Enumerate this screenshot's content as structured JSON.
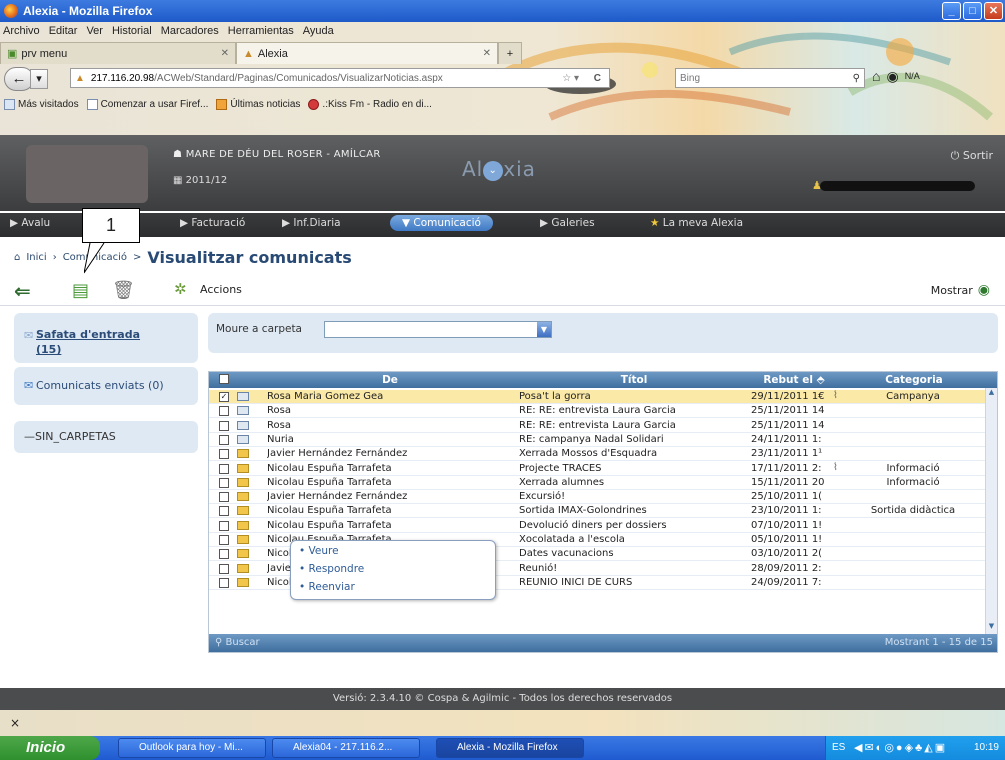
{
  "window": {
    "title": "Alexia - Mozilla Firefox"
  },
  "menubar": [
    "Archivo",
    "Editar",
    "Ver",
    "Historial",
    "Marcadores",
    "Herramientas",
    "Ayuda"
  ],
  "tabs": [
    {
      "label": "prv menu"
    },
    {
      "label": "Alexia"
    }
  ],
  "url": {
    "host": "217.116.20.98",
    "path": "/ACWeb/Standard/Paginas/Comunicados/VisualizarNoticias.aspx"
  },
  "search": {
    "placeholder": "Bing"
  },
  "addon_label": "N/A",
  "bookmarks": [
    "Más visitados",
    "Comenzar a usar Firef...",
    "Últimas noticias",
    ".:Kiss Fm - Radio en di..."
  ],
  "app": {
    "school": "MARE DE DÉU DEL ROSER - AMÍLCAR",
    "year": "2011/12",
    "brand": "Alexia",
    "sortir": "Sortir"
  },
  "nav": [
    "Avalu",
    "Facturació",
    "Inf.Diaria",
    "Comunicació",
    "Galeries",
    "La meva Alexia"
  ],
  "breadcrumb": {
    "home": "Inici",
    "section": "Comunicació",
    "current": "Visualitzar comunicats"
  },
  "callout": "1",
  "toolbar": {
    "accions": "Accions",
    "mostrar": "Mostrar"
  },
  "sidebar": {
    "inbox": "Safata d'entrada (15)",
    "sent": "Comunicats enviats (0)",
    "folders": "—SIN_CARPETAS"
  },
  "folder_bar": {
    "label": "Moure a carpeta"
  },
  "grid": {
    "columns": [
      "De",
      "Títol",
      "Rebut el",
      "Categoria"
    ],
    "rows": [
      {
        "from": "Rosa Maria Gomez Gea",
        "title": "Posa't la gorra",
        "date": "29/11/2011 1€",
        "category": "Campanya",
        "checked": true
      },
      {
        "from": "Rosa",
        "title": "RE: RE: entrevista Laura Garcia",
        "date": "25/11/2011 14",
        "category": ""
      },
      {
        "from": "Rosa",
        "title": "RE: RE: entrevista Laura Garcia",
        "date": "25/11/2011 14",
        "category": ""
      },
      {
        "from": "Nuria",
        "title": "RE: campanya Nadal Solidari",
        "date": "24/11/2011 1:",
        "category": ""
      },
      {
        "from": "Javier Hernández Fernández",
        "title": "Xerrada Mossos d'Esquadra",
        "date": "23/11/2011 1¹",
        "category": ""
      },
      {
        "from": "Nicolau Espuña Tarrafeta",
        "title": "Projecte TRACES",
        "date": "17/11/2011 2:",
        "category": "Informació"
      },
      {
        "from": "Nicolau Espuña Tarrafeta",
        "title": "Xerrada alumnes",
        "date": "15/11/2011 20",
        "category": "Informació"
      },
      {
        "from": "Javier Hernández Fernández",
        "title": "Excursió!",
        "date": "25/10/2011 1(",
        "category": ""
      },
      {
        "from": "Nicolau Espuña Tarrafeta",
        "title": "Sortida IMAX-Golondrines",
        "date": "23/10/2011 1:",
        "category": "Sortida didàctica"
      },
      {
        "from": "Nicolau Espuña Tarrafeta",
        "title": "Devolució diners per dossiers",
        "date": "07/10/2011 1!",
        "category": ""
      },
      {
        "from": "Nicolau Espuña Tarrafeta",
        "title": "Xocolatada a l'escola",
        "date": "05/10/2011 1!",
        "category": ""
      },
      {
        "from": "Nicolau Espuña Tarrafeta",
        "title": "Dates vacunacions",
        "date": "03/10/2011 2(",
        "category": ""
      },
      {
        "from": "Javier Hernández Fernández",
        "title": "Reunió!",
        "date": "28/09/2011 2:",
        "category": ""
      },
      {
        "from": "Nicolau Espuña Tarrafeta",
        "title": "REUNIÓ INICI DE CURS",
        "date": "24/09/2011 7:",
        "category": ""
      }
    ],
    "footer_search": "Buscar",
    "footer_count": "Mostrant 1 - 15 de 15"
  },
  "context_menu": [
    "• Veure",
    "• Respondre",
    "• Reenviar"
  ],
  "footer": "Versió: 2.3.4.10 © Cospa & Agilmic - Todos los derechos reservados",
  "status": "×",
  "taskbar": {
    "start": "Inicio",
    "tasks": [
      "Outlook para hoy - Mi...",
      "Alexia04 - 217.116.2...",
      "Alexia - Mozilla Firefox"
    ],
    "lang": "ES",
    "time": "10:19"
  },
  "colors": {
    "header": "#4a4b4d",
    "accent": "#3f79c4",
    "grid_header": "#5a86b4",
    "highlight_row": "#fbe9a8"
  }
}
